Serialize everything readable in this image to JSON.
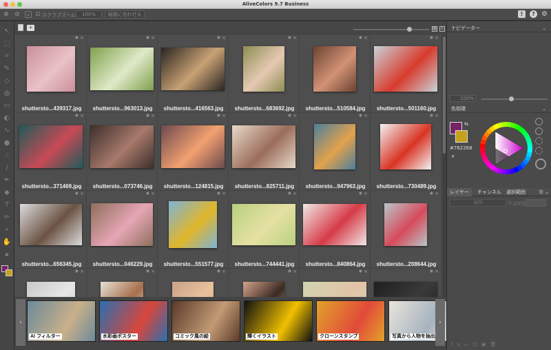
{
  "window": {
    "title": "AliveColors 9.7 Business"
  },
  "options": {
    "scrub_zoom": "スクラブズーム",
    "zoom_value": "100%",
    "fit_screen": "画面に合わせる"
  },
  "thumbnails": [
    {
      "name": "shuttersto...439317.jpg",
      "c": "#c98f9a",
      "c2": "#e9c2c6"
    },
    {
      "name": "shuttersto...963013.jpg",
      "c": "#7fa14e",
      "c2": "#dfe9c8"
    },
    {
      "name": "shuttersto...416563.jpg",
      "c": "#2a2521",
      "c2": "#c9a274"
    },
    {
      "name": "shuttersto...683692.jpg",
      "c": "#8c8d53",
      "c2": "#e6c9b3"
    },
    {
      "name": "shuttersto...510584.jpg",
      "c": "#6b4230",
      "c2": "#d29276"
    },
    {
      "name": "shuttersto...501160.jpg",
      "c": "#c9d2d8",
      "c2": "#d83b2c"
    },
    {
      "name": "shuttersto...371469.jpg",
      "c": "#1f5b5a",
      "c2": "#c84a55"
    },
    {
      "name": "shuttersto...073746.jpg",
      "c": "#3d2f2b",
      "c2": "#a7796a"
    },
    {
      "name": "shuttersto...124815.jpg",
      "c": "#6c4a4e",
      "c2": "#f3a06f"
    },
    {
      "name": "shuttersto...825711.jpg",
      "c": "#e8d9c9",
      "c2": "#9b6d5b"
    },
    {
      "name": "shuttersto...947963.jpg",
      "c": "#4d7e9c",
      "c2": "#e2a24c"
    },
    {
      "name": "shuttersto...730489.jpg",
      "c": "#f2f2f2",
      "c2": "#d83424"
    },
    {
      "name": "shuttersto...656345.jpg",
      "c": "#dcdcdc",
      "c2": "#6b5344"
    },
    {
      "name": "shuttersto...046229.jpg",
      "c": "#8e6f5b",
      "c2": "#e6a6b6"
    },
    {
      "name": "shuttersto...551577.jpg",
      "c": "#7fb3d6",
      "c2": "#e0b62a"
    },
    {
      "name": "shuttersto...744441.jpg",
      "c": "#b8d07e",
      "c2": "#e6e1a3"
    },
    {
      "name": "shuttersto...840864.jpg",
      "c": "#f0e8e6",
      "c2": "#d63b48"
    },
    {
      "name": "shuttersto...208644.jpg",
      "c": "#b8c5c8",
      "c2": "#d64b5b"
    },
    {
      "name": "",
      "c": "#c9c9c9",
      "c2": "#e6e6e6"
    },
    {
      "name": "",
      "c": "#e6e0d6",
      "c2": "#a76f4b"
    },
    {
      "name": "",
      "c": "#c9a08a",
      "c2": "#e9c29c"
    },
    {
      "name": "",
      "c": "#d4a38a",
      "c2": "#3a2a22"
    },
    {
      "name": "",
      "c": "#cfd5b0",
      "c2": "#e2c3a7"
    },
    {
      "name": "",
      "c": "#1f1f1f",
      "c2": "#3a3a3a"
    }
  ],
  "features": [
    {
      "label": "AI フィルター",
      "c": "#6c8a9a",
      "c2": "#c9b08a"
    },
    {
      "label": "水彩画ポスター",
      "c": "#2a6fb0",
      "c2": "#d9463c"
    },
    {
      "label": "コミック風の絵",
      "c": "#5a3a2a",
      "c2": "#c29a74"
    },
    {
      "label": "輝くイラスト",
      "c": "#111111",
      "c2": "#f0c000"
    },
    {
      "label": "クローンスタンプ",
      "c": "#e3a22a",
      "c2": "#e14a3a"
    },
    {
      "label": "写真から人物を抽出",
      "c": "#e9e4dc",
      "c2": "#a6b3bf"
    }
  ],
  "panels": {
    "navigator": "ナビゲーター",
    "nav_zoom": "100%",
    "color_wheel": "色相環",
    "hex": "#762268",
    "tabs": [
      "レイヤー",
      "チャンネル",
      "選択範囲"
    ],
    "blend_mode": "通常",
    "opacity_label": "不透明度"
  },
  "colors": {
    "foreground": "#762268",
    "background": "#c4a21a"
  }
}
